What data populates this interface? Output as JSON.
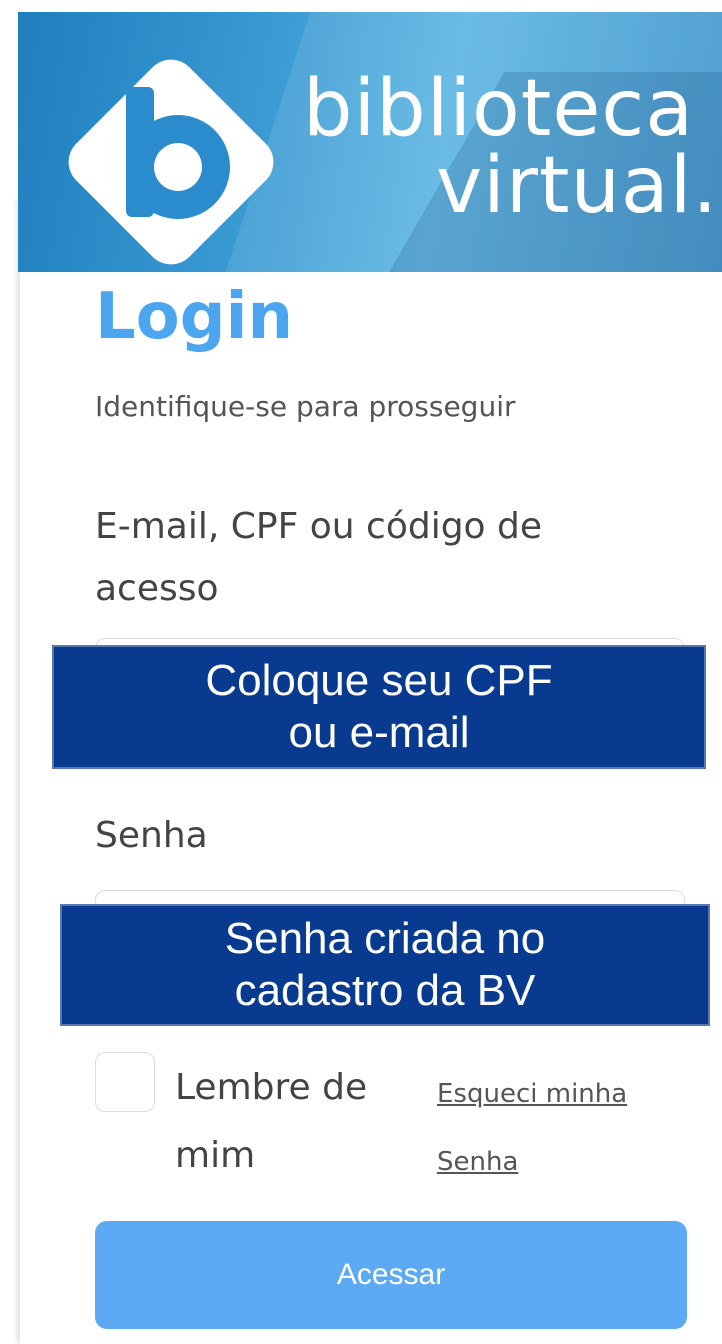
{
  "brand": {
    "line1": "biblioteca",
    "line2": "virtual."
  },
  "login": {
    "title": "Login",
    "subtitle": "Identifique-se para prosseguir",
    "identifier_label": "E-mail, CPF ou código de acesso",
    "identifier_value": "",
    "password_label": "Senha",
    "password_value": "",
    "remember_label": "Lembre de mim",
    "remember_checked": false,
    "forgot_link": "Esqueci minha Senha",
    "submit_label": "Acessar"
  },
  "callouts": {
    "identifier_line1": "Coloque seu CPF",
    "identifier_line2": "ou e-mail",
    "password_line1": "Senha criada no",
    "password_line2": "cadastro da BV"
  },
  "colors": {
    "title": "#4ba6ef",
    "submit": "#5baaf3",
    "callout": "#083b8f"
  },
  "icons": {
    "logo": "biblioteca-virtual-logo-icon"
  }
}
